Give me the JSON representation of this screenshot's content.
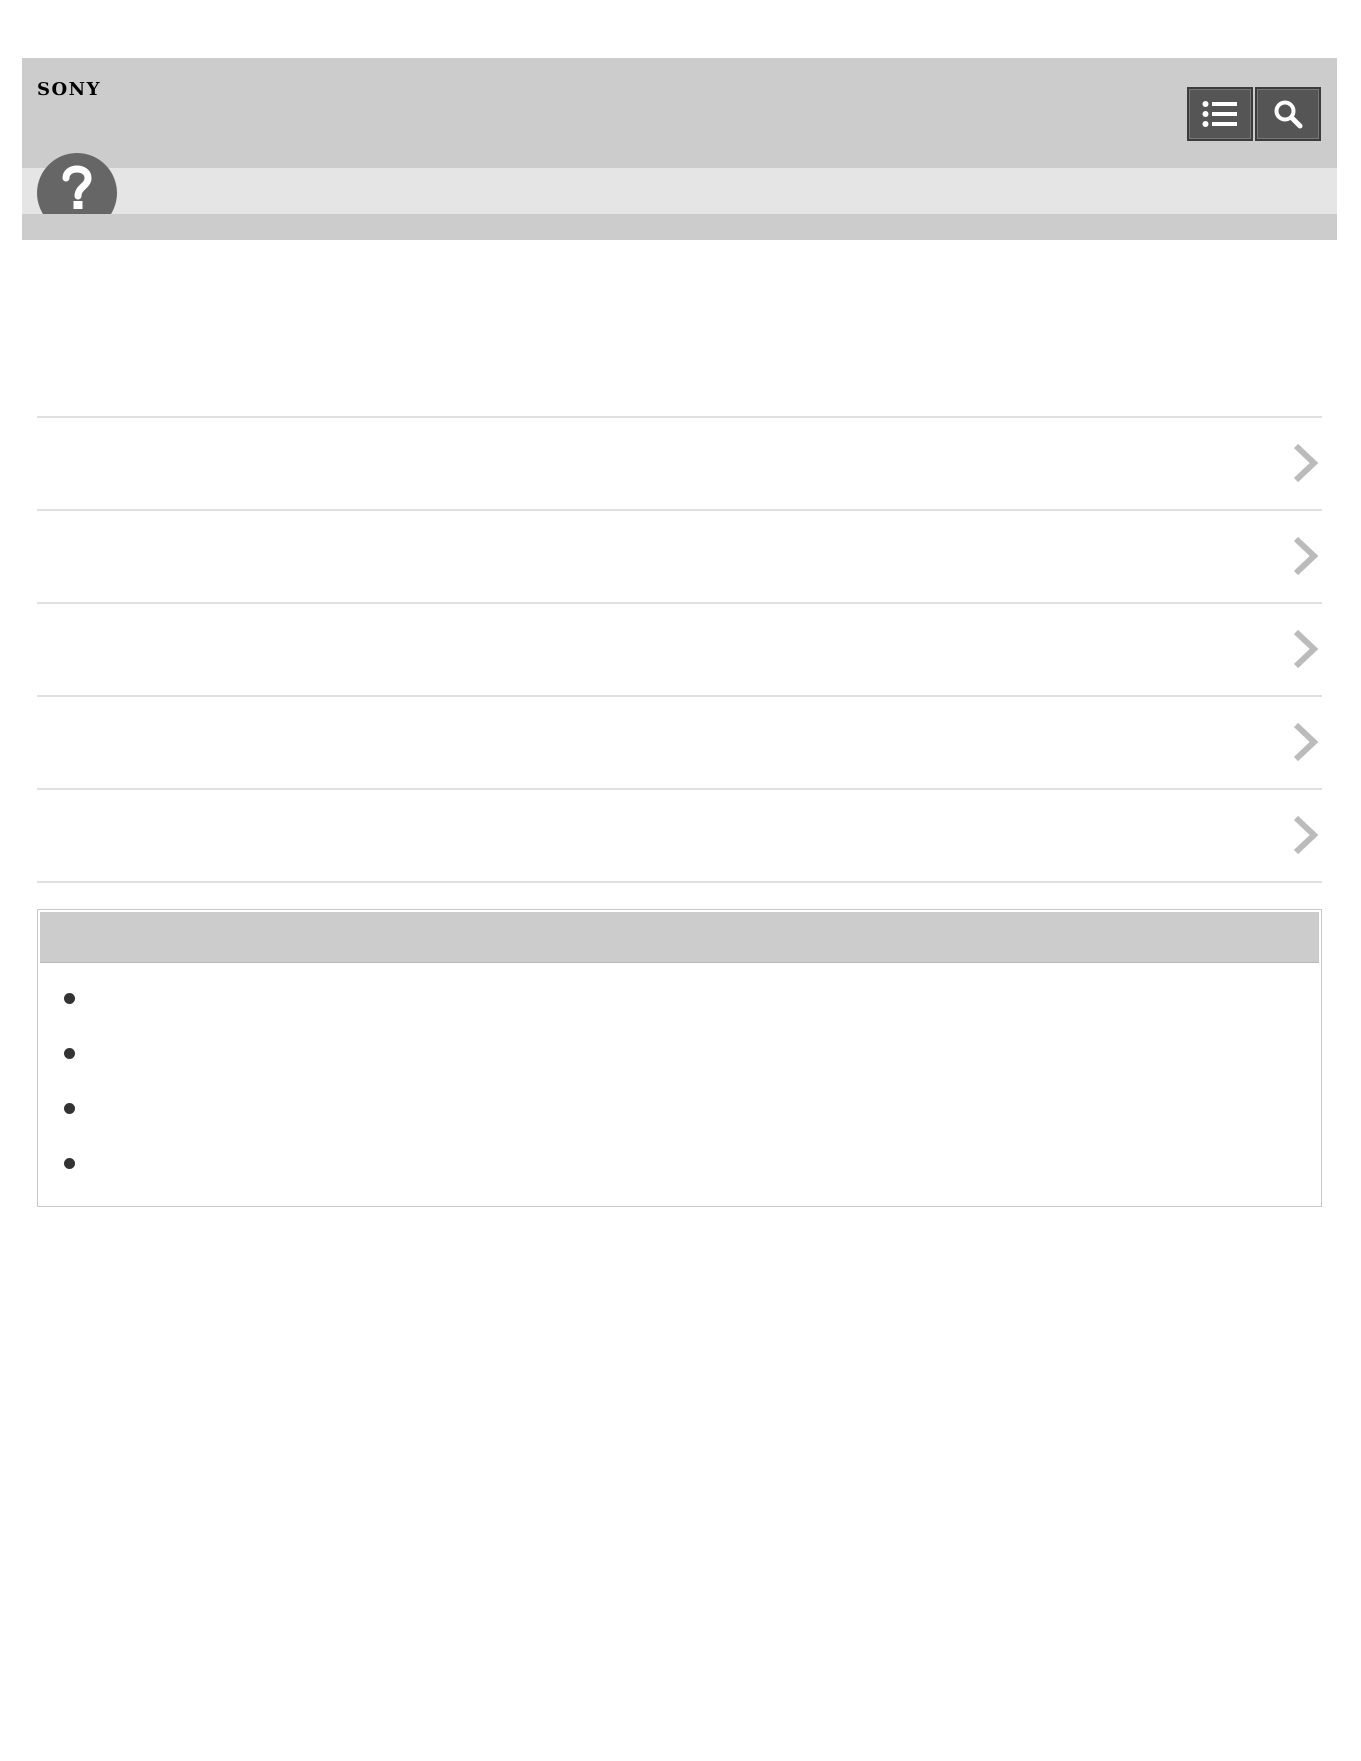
{
  "header": {
    "brand": "SONY",
    "toc_button_label": "",
    "search_button_label": ""
  },
  "subheader": {
    "title": ""
  },
  "nav_items": [
    {
      "label": ""
    },
    {
      "label": ""
    },
    {
      "label": ""
    },
    {
      "label": ""
    },
    {
      "label": ""
    }
  ],
  "info_box": {
    "title": "",
    "items": [
      {
        "text": ""
      },
      {
        "text": ""
      },
      {
        "text": ""
      },
      {
        "text": ""
      }
    ]
  },
  "colors": {
    "header_bg": "#cccccc",
    "subbar_bg": "#e5e5e5",
    "button_bg": "#555555",
    "help_icon": "#666666",
    "chevron": "#bbbbbb"
  },
  "icons": {
    "toc": "list-icon",
    "search": "search-icon",
    "help": "question-mark-icon",
    "nav": "chevron-right-icon",
    "bullet": "bullet-dot-icon"
  }
}
